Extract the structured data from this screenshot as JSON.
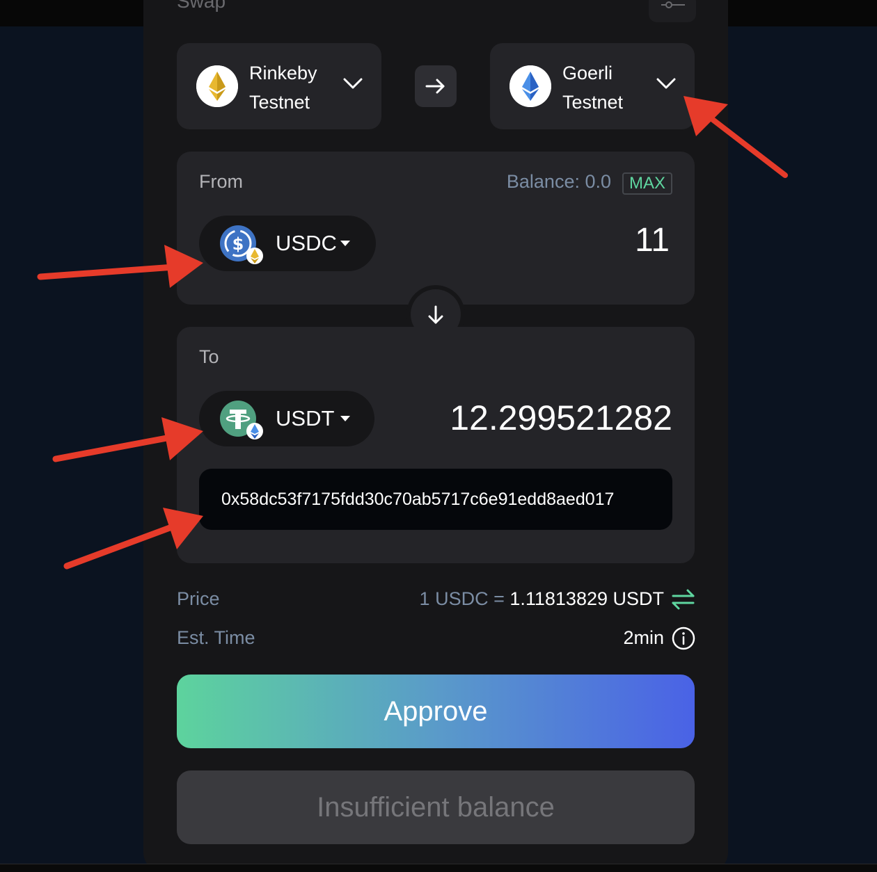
{
  "header": {
    "title": "Swap"
  },
  "chains": {
    "from": {
      "name_line1": "Rinkeby",
      "name_line2": "Testnet",
      "icon": "ethereum-gold-icon"
    },
    "to": {
      "name_line1": "Goerli",
      "name_line2": "Testnet",
      "icon": "ethereum-blue-icon"
    }
  },
  "from_box": {
    "label": "From",
    "balance": "Balance: 0.0",
    "max_label": "MAX",
    "token": "USDC",
    "amount": "11"
  },
  "to_box": {
    "label": "To",
    "token": "USDT",
    "amount": "12.299521282",
    "recipient_address": "0x58dc53f7175fdd30c70ab5717c6e91edd8aed017"
  },
  "details": {
    "price_label": "Price",
    "price_prefix": "1 USDC = ",
    "price_value": "1.11813829 USDT",
    "time_label": "Est. Time",
    "time_value": "2min"
  },
  "actions": {
    "approve_label": "Approve",
    "insufficient_label": "Insufficient balance"
  },
  "colors": {
    "accent_green": "#5fd6a0",
    "accent_blue": "#4a62e6",
    "annotation_arrow": "#e63b2a"
  }
}
